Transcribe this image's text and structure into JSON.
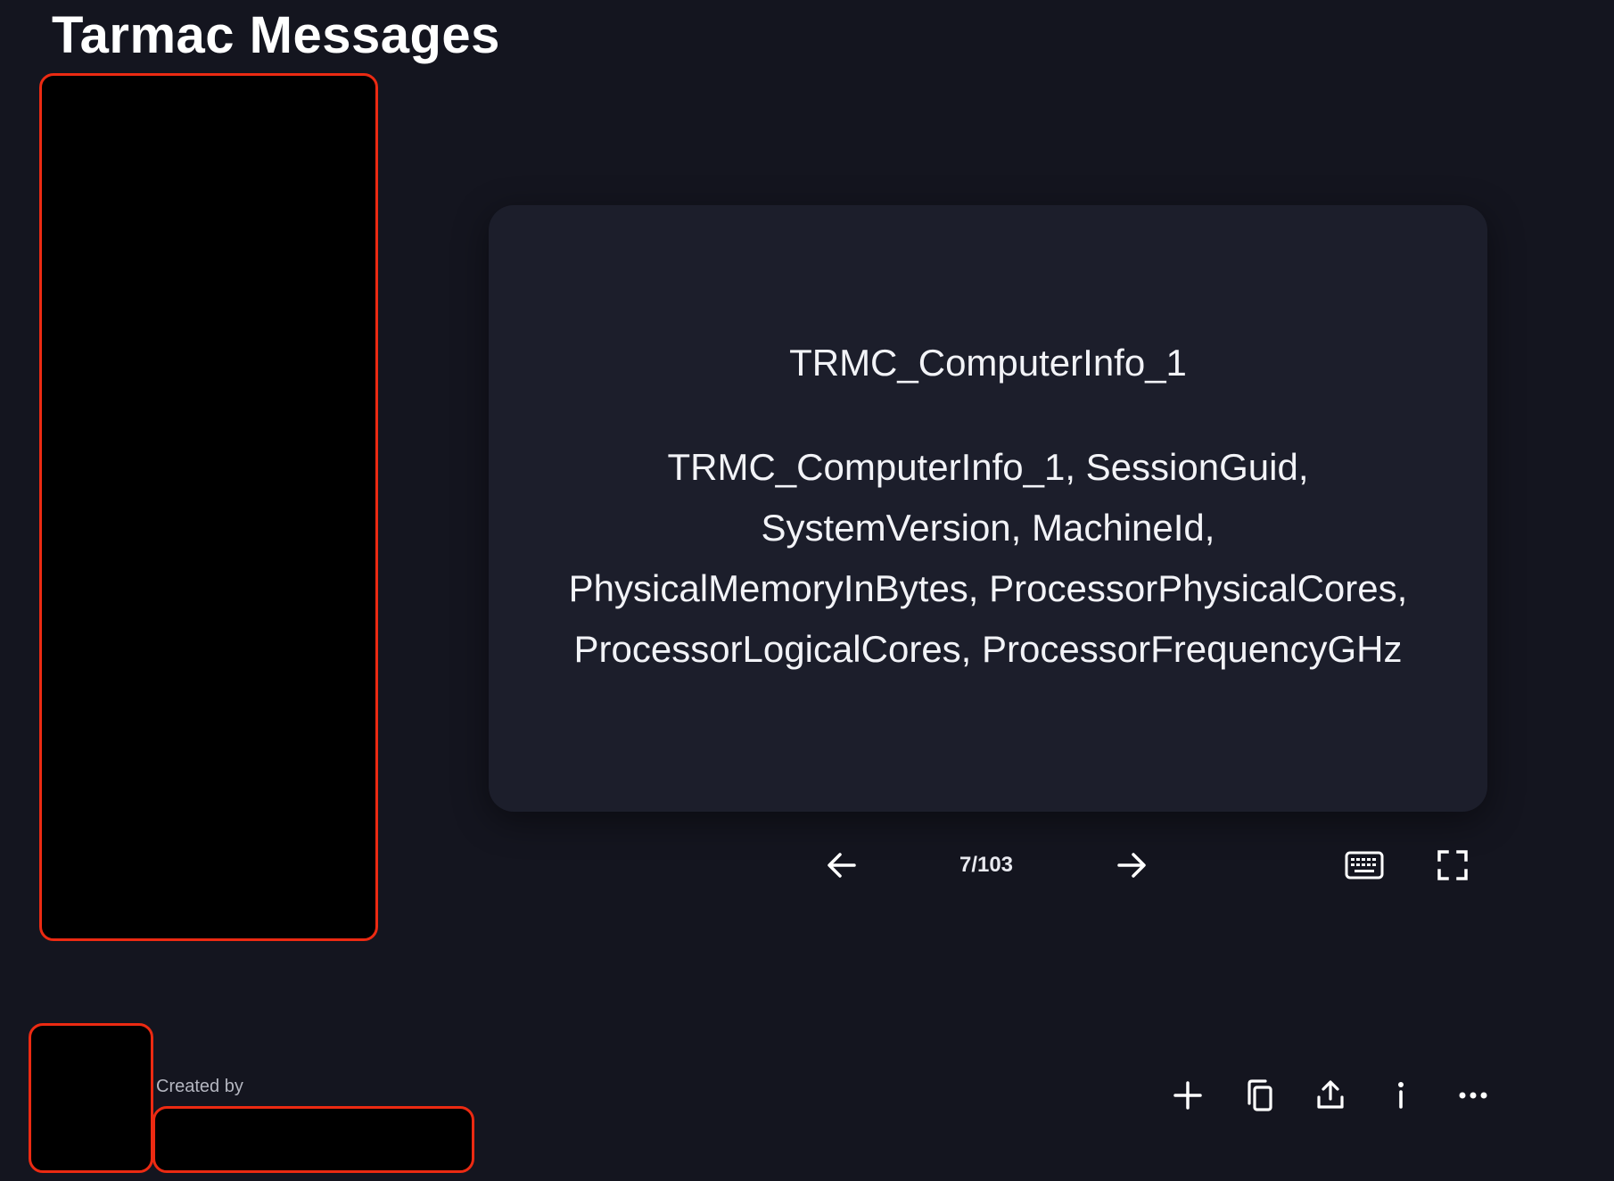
{
  "header": {
    "title": "Tarmac Messages"
  },
  "card": {
    "term": "TRMC_ComputerInfo_1",
    "definition": "TRMC_ComputerInfo_1, SessionGuid, SystemVersion, MachineId, PhysicalMemoryInBytes, ProcessorPhysicalCores, ProcessorLogicalCores, ProcessorFrequencyGHz"
  },
  "navigation": {
    "counter": "7/103",
    "prev_icon": "arrow-left-icon",
    "next_icon": "arrow-right-icon",
    "keyboard_icon": "keyboard-icon",
    "fullscreen_icon": "fullscreen-icon"
  },
  "footer": {
    "created_by_label": "Created by"
  },
  "actions": {
    "icons": [
      "plus-icon",
      "copy-icon",
      "share-icon",
      "info-icon",
      "more-icon"
    ]
  },
  "colors": {
    "background": "#14151f",
    "card": "#1c1e2b",
    "redaction_border": "#ec2a12",
    "text": "#ffffff"
  }
}
